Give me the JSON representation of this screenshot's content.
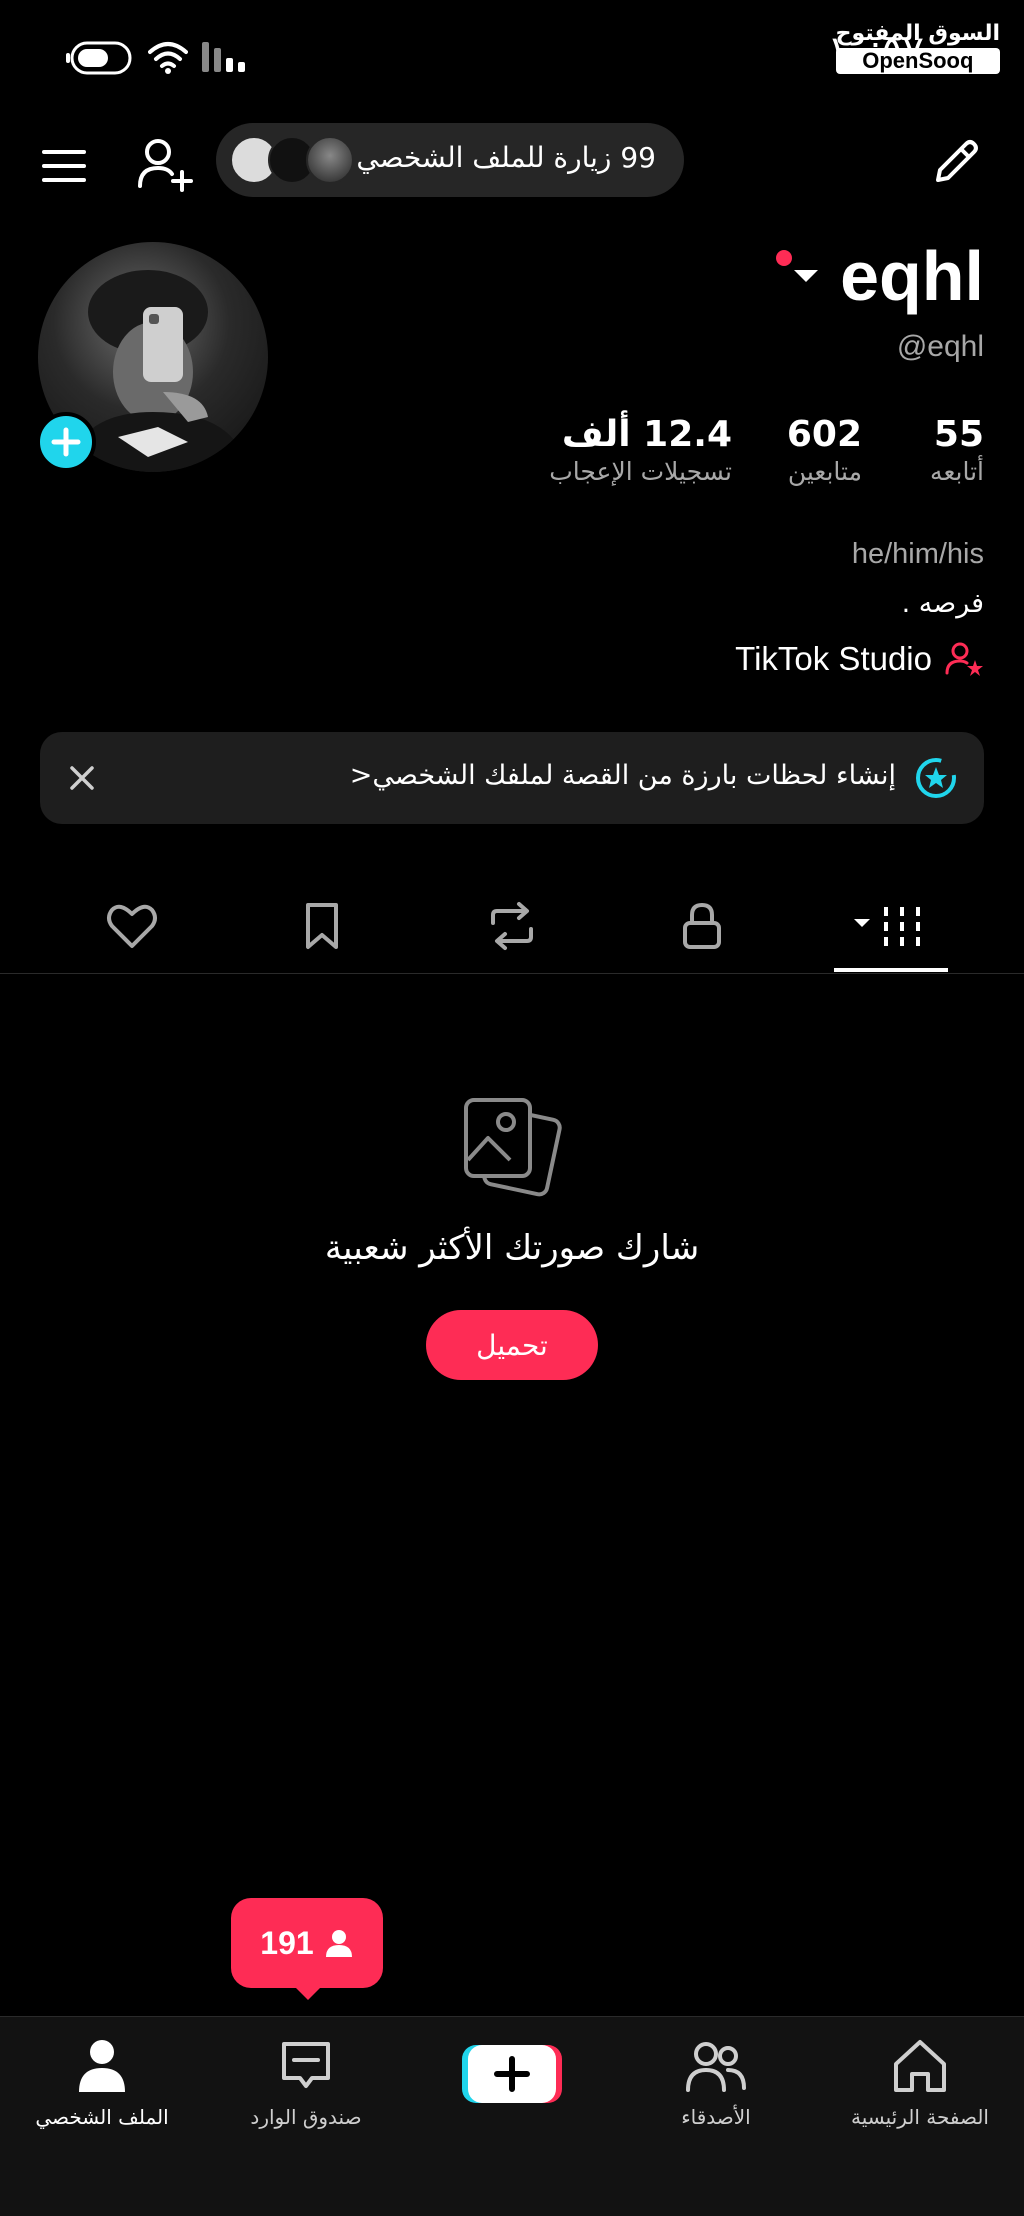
{
  "status": {
    "time": "١٠:٥٧"
  },
  "watermark": {
    "arabic": "السوق المفتوح",
    "brand": "OpenSooq"
  },
  "header": {
    "visits_text": "99 زيارة للملف الشخصي"
  },
  "profile": {
    "username": "eqhl",
    "handle": "@eqhl",
    "stats": [
      {
        "value": "55",
        "label": "أتابعه"
      },
      {
        "value": "602",
        "label": "متابعين"
      },
      {
        "value": "12.4 ألف",
        "label": "تسجيلات الإعجاب"
      }
    ],
    "pronouns": "he/him/his",
    "bio": "فرصه .",
    "studio_link": "TikTok Studio"
  },
  "banner": {
    "text": "إنشاء لحظات بارزة من القصة لملفك الشخصي<"
  },
  "empty_state": {
    "title": "شارك صورتك الأكثر شعبية",
    "button": "تحميل"
  },
  "notification_bubble": {
    "count": "191"
  },
  "bottom_nav": {
    "home": "الصفحة الرئيسية",
    "friends": "الأصدقاء",
    "inbox": "صندوق الوارد",
    "profile": "الملف الشخصي"
  },
  "colors": {
    "accent": "#fe2c55",
    "cyan": "#20d5ec",
    "background": "#000000"
  }
}
